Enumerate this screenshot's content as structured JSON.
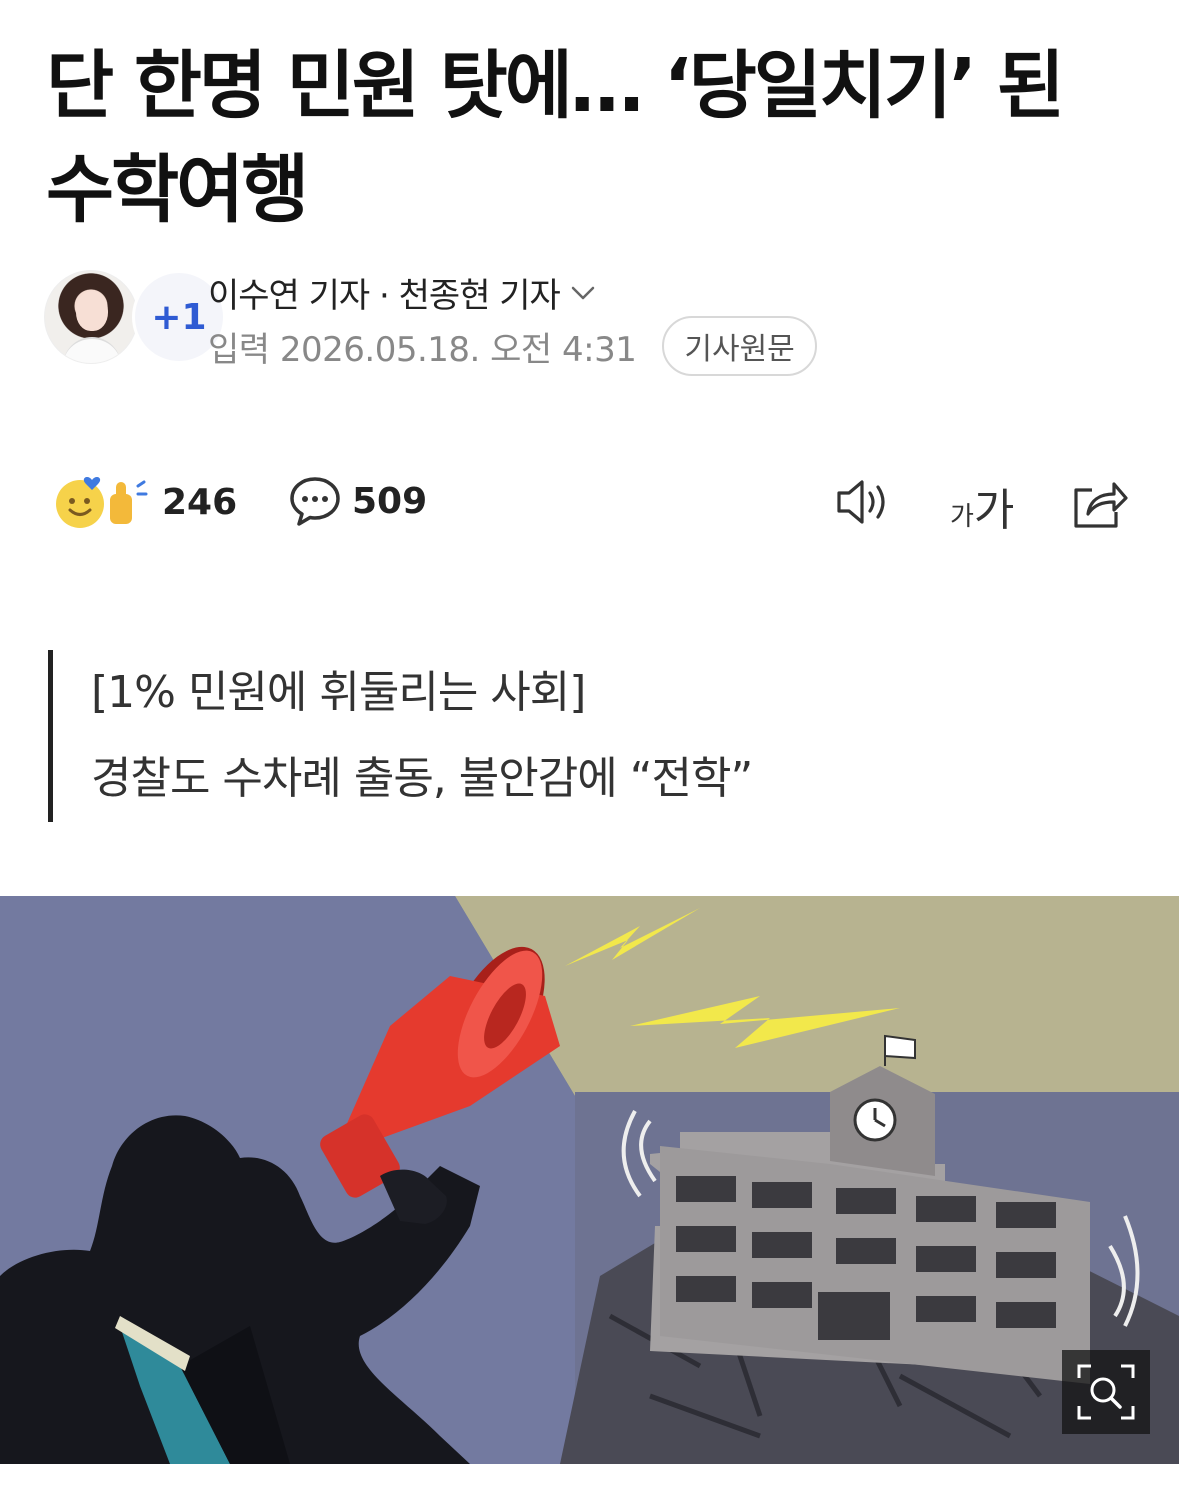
{
  "article": {
    "headline_line1": "단 한명 민원 탓에… ‘당일치기’ 된",
    "headline_line2": "수학여행",
    "authors": "이수연 기자 · 천종현 기자",
    "extra_authors_badge": "+1",
    "published": "입력 2026.05.18. 오전 4:31",
    "original_button": "기사원문",
    "summary_line1": "[1% 민원에 휘둘리는 사회]",
    "summary_line2": "경찰도 수차례 출동, 불안감에 “전학”"
  },
  "actions": {
    "reaction_count": "246",
    "comment_count": "509",
    "font_size_small": "가",
    "font_size_large": "가"
  },
  "icons": {
    "audio": "speaker-icon",
    "share": "share-icon",
    "zoom": "zoom-icon",
    "comment": "comment-bubble-icon",
    "reaction": "reaction-emoji-icon",
    "expand": "chevron-down-icon"
  },
  "colors": {
    "extra_badge": "#2f5bd3",
    "megaphone": "#e53a2e",
    "lightning": "#f2e84b"
  }
}
